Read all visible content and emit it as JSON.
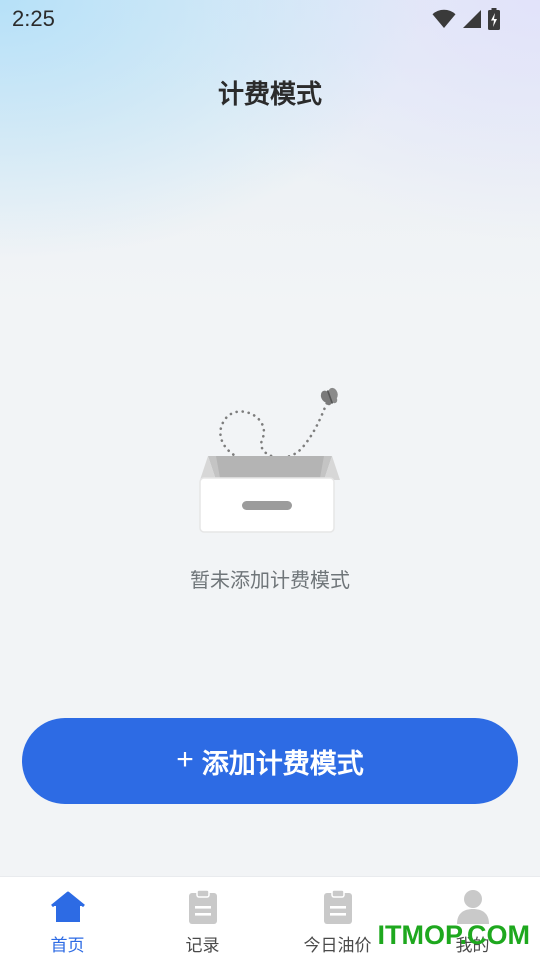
{
  "status_bar": {
    "time": "2:25",
    "icons": [
      "wifi-icon",
      "signal-icon",
      "battery-charging-icon"
    ]
  },
  "header": {
    "title": "计费模式"
  },
  "empty_state": {
    "illustration": "empty-box-butterfly-illustration",
    "message": "暂未添加计费模式"
  },
  "actions": {
    "add_icon": "+",
    "add_label": "添加计费模式",
    "accent": "#2d6be4"
  },
  "bottom_nav": {
    "items": [
      {
        "label": "首页",
        "icon": "home-icon",
        "active": true
      },
      {
        "label": "记录",
        "icon": "clipboard-icon",
        "active": false
      },
      {
        "label": "今日油价",
        "icon": "clipboard-icon",
        "active": false
      },
      {
        "label": "我的",
        "icon": "user-icon",
        "active": false
      }
    ],
    "active_color": "#2d6be4"
  },
  "watermark": {
    "text": "ITMOP.COM",
    "color": "#1ea81e"
  }
}
